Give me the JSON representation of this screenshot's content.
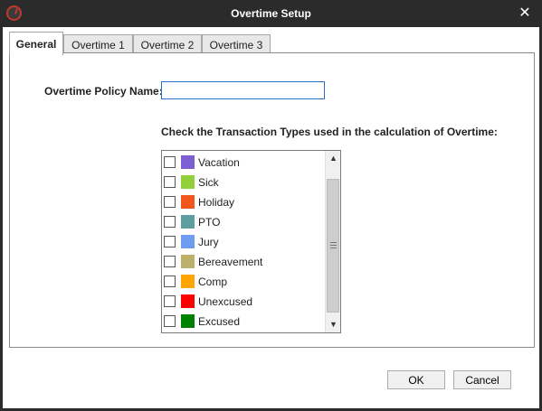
{
  "window": {
    "title": "Overtime Setup",
    "close_glyph": "✕"
  },
  "tabs": [
    {
      "label": "General"
    },
    {
      "label": "Overtime 1"
    },
    {
      "label": "Overtime 2"
    },
    {
      "label": "Overtime 3"
    }
  ],
  "general": {
    "policy_name_label": "Overtime Policy Name:",
    "policy_name_value": "",
    "transaction_types_label": "Check the Transaction Types used in the calculation of Overtime:"
  },
  "transaction_types": [
    {
      "label": "Vacation",
      "color": "#7b5fd3",
      "checked": false
    },
    {
      "label": "Sick",
      "color": "#92cf3a",
      "checked": false
    },
    {
      "label": "Holiday",
      "color": "#f2561d",
      "checked": false
    },
    {
      "label": "PTO",
      "color": "#5e9ea0",
      "checked": false
    },
    {
      "label": "Jury",
      "color": "#6f9cf0",
      "checked": false
    },
    {
      "label": "Bereavement",
      "color": "#bdb06b",
      "checked": false
    },
    {
      "label": "Comp",
      "color": "#ffa500",
      "checked": false
    },
    {
      "label": "Unexcused",
      "color": "#ff0000",
      "checked": false
    },
    {
      "label": "Excused",
      "color": "#008000",
      "checked": false
    }
  ],
  "buttons": {
    "ok_label": "OK",
    "cancel_label": "Cancel"
  }
}
